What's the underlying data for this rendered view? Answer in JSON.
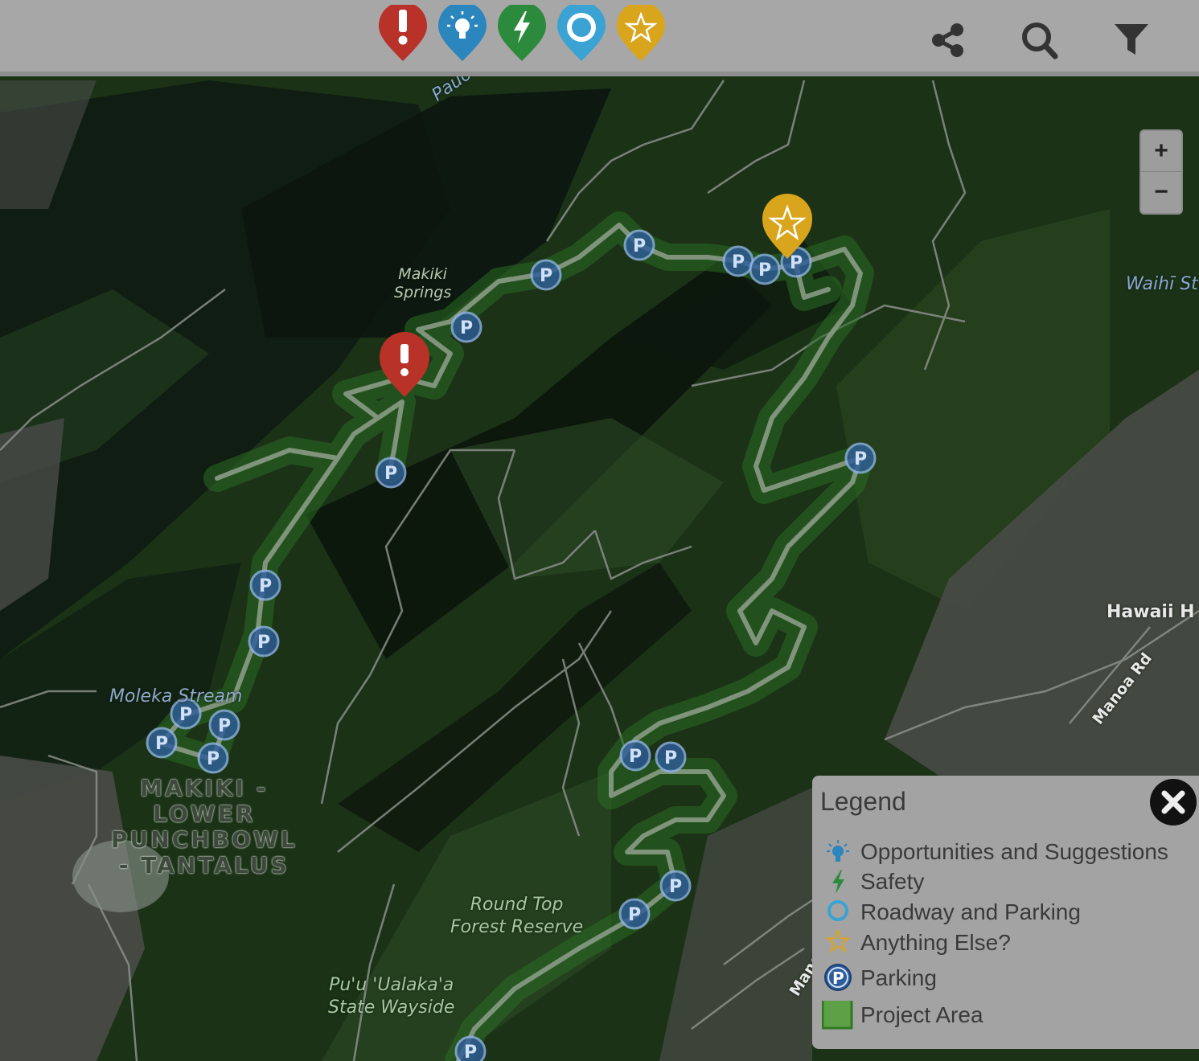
{
  "categories": [
    {
      "name": "Issue",
      "color": "#c0392b",
      "icon": "exclamation-icon"
    },
    {
      "name": "Opportunities and Suggestions",
      "color": "#2e86c1",
      "icon": "lightbulb-icon"
    },
    {
      "name": "Safety",
      "color": "#2e8b3e",
      "icon": "lightning-icon"
    },
    {
      "name": "Roadway and Parking",
      "color": "#3aa6d6",
      "icon": "ring-icon"
    },
    {
      "name": "Anything Else?",
      "color": "#e0a820",
      "icon": "star-icon"
    }
  ],
  "toolbar": {
    "share_icon": "share-icon",
    "search_icon": "search-icon",
    "filter_icon": "filter-icon"
  },
  "zoom": {
    "in_label": "+",
    "out_label": "−"
  },
  "map_labels": {
    "pauoa": "Pauoa St",
    "makiki_springs": "Makiki\nSprings",
    "waihi": "Waihī St",
    "moleka": "Moleka Stream",
    "region": "MAKIKI -\nLOWER\nPUNCHBOWL\n- TANTALUS",
    "round_top": "Round Top\nForest Reserve",
    "puu": "Pu'u 'Ualaka'a\nState Wayside",
    "hawaii": "Hawaii H",
    "manoa_rd": "Manoa Rd",
    "mano": "Mano"
  },
  "markers": [
    {
      "type": "Issue",
      "icon": "exclamation-icon"
    },
    {
      "type": "Anything Else?",
      "icon": "star-icon"
    }
  ],
  "legend": {
    "title": "Legend",
    "items": [
      {
        "label": "Opportunities and Suggestions",
        "icon": "lightbulb-icon"
      },
      {
        "label": "Safety",
        "icon": "lightning-icon"
      },
      {
        "label": "Roadway and Parking",
        "icon": "ring-icon"
      },
      {
        "label": "Anything Else?",
        "icon": "star-icon"
      },
      {
        "label": "Parking",
        "icon": "parking-icon"
      },
      {
        "label": "Project Area",
        "icon": "project-area-swatch"
      }
    ]
  }
}
